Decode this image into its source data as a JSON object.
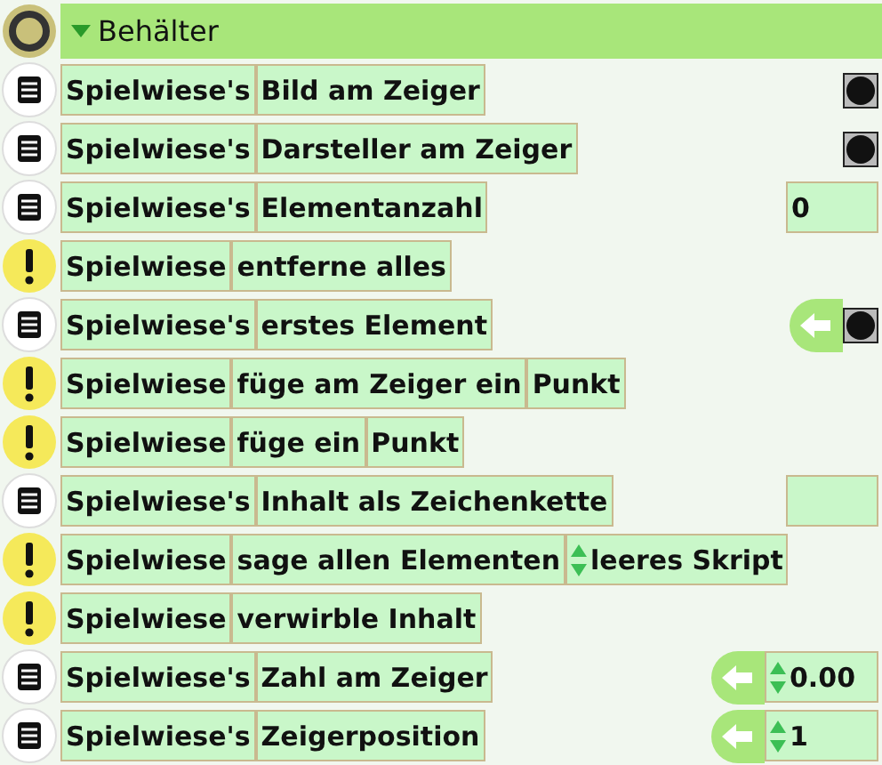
{
  "header": {
    "label": "Behälter",
    "expanded": true
  },
  "rows": [
    {
      "kind": "getter",
      "receiver": "Spielwiese's",
      "action": "Bild am Zeiger",
      "result": {
        "kind": "image"
      }
    },
    {
      "kind": "getter",
      "receiver": "Spielwiese's",
      "action": "Darsteller am Zeiger",
      "result": {
        "kind": "image"
      }
    },
    {
      "kind": "getter",
      "receiver": "Spielwiese's",
      "action": "Elementanzahl",
      "result": {
        "kind": "field",
        "text": "0"
      }
    },
    {
      "kind": "command",
      "receiver": "Spielwiese",
      "action": "entferne alles"
    },
    {
      "kind": "getter",
      "receiver": "Spielwiese's",
      "action": "erstes Element",
      "result": {
        "kind": "arrow-image"
      }
    },
    {
      "kind": "command",
      "receiver": "Spielwiese",
      "action": "füge am Zeiger ein",
      "arg": {
        "kind": "tile",
        "text": "Punkt"
      }
    },
    {
      "kind": "command",
      "receiver": "Spielwiese",
      "action": "füge ein",
      "arg": {
        "kind": "tile",
        "text": "Punkt"
      }
    },
    {
      "kind": "getter",
      "receiver": "Spielwiese's",
      "action": "Inhalt als Zeichenkette",
      "result": {
        "kind": "field"
      }
    },
    {
      "kind": "command",
      "receiver": "Spielwiese",
      "action": "sage allen Elementen",
      "arg": {
        "kind": "spinner",
        "text": "leeres Skript"
      }
    },
    {
      "kind": "command",
      "receiver": "Spielwiese",
      "action": "verwirble Inhalt"
    },
    {
      "kind": "getter",
      "receiver": "Spielwiese's",
      "action": "Zahl am Zeiger",
      "result": {
        "kind": "arrow-spinner",
        "text": "0.00"
      }
    },
    {
      "kind": "getter",
      "receiver": "Spielwiese's",
      "action": "Zeigerposition",
      "result": {
        "kind": "arrow-spinner",
        "text": "1"
      }
    }
  ]
}
